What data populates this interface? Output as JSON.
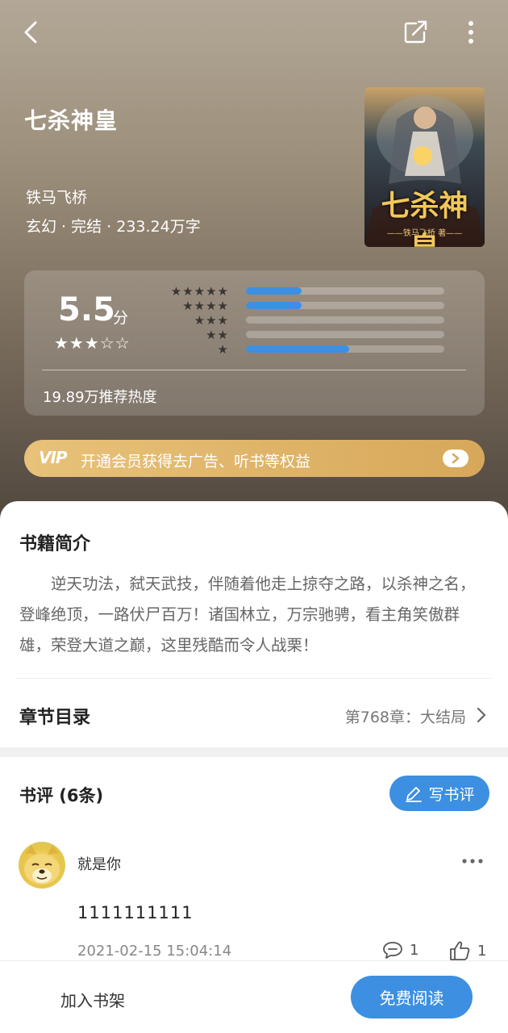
{
  "header": {
    "back_icon": "chevron-left-icon",
    "share_icon": "share-icon",
    "more_icon": "more-vertical-icon"
  },
  "book": {
    "title": "七杀神皇",
    "author": "铁马飞桥",
    "meta": "玄幻 · 完结 · 233.24万字",
    "cover_title": "七杀神皇",
    "cover_subtitle": "——铁马飞桥 著——"
  },
  "rating": {
    "score": "5.5",
    "unit": "分",
    "stars_display": "★★★☆☆",
    "distribution": [
      {
        "stars": "★★★★★",
        "fraction": 0.28
      },
      {
        "stars": "★★★★",
        "fraction": 0.28
      },
      {
        "stars": "★★★",
        "fraction": 0.0
      },
      {
        "stars": "★★",
        "fraction": 0.0
      },
      {
        "stars": "★",
        "fraction": 0.52
      }
    ],
    "hotness": "19.89万推荐热度"
  },
  "vip": {
    "logo": "VIP",
    "text": "开通会员获得去广告、听书等权益"
  },
  "intro": {
    "title": "书籍简介",
    "text": "逆天功法，弑天武技，伴随着他走上掠夺之路，以杀神之名，登峰绝顶，一路伏尸百万！诸国林立，万宗驰骋，看主角笑傲群雄，荣登大道之巅，这里残酷而令人战栗！"
  },
  "chapters": {
    "title": "章节目录",
    "latest": "第768章：大结局"
  },
  "reviews": {
    "title": "书评 (6条)",
    "write_label": "写书评",
    "items": [
      {
        "username": "就是你",
        "body": "1111111111",
        "time": "2021-02-15 15:04:14",
        "comments": "1",
        "likes": "1"
      }
    ]
  },
  "bottom": {
    "shelf_label": "加入书架",
    "read_label": "免费阅读"
  },
  "colors": {
    "accent": "#3d8fe1",
    "vip_gold": "#d7a85b"
  }
}
